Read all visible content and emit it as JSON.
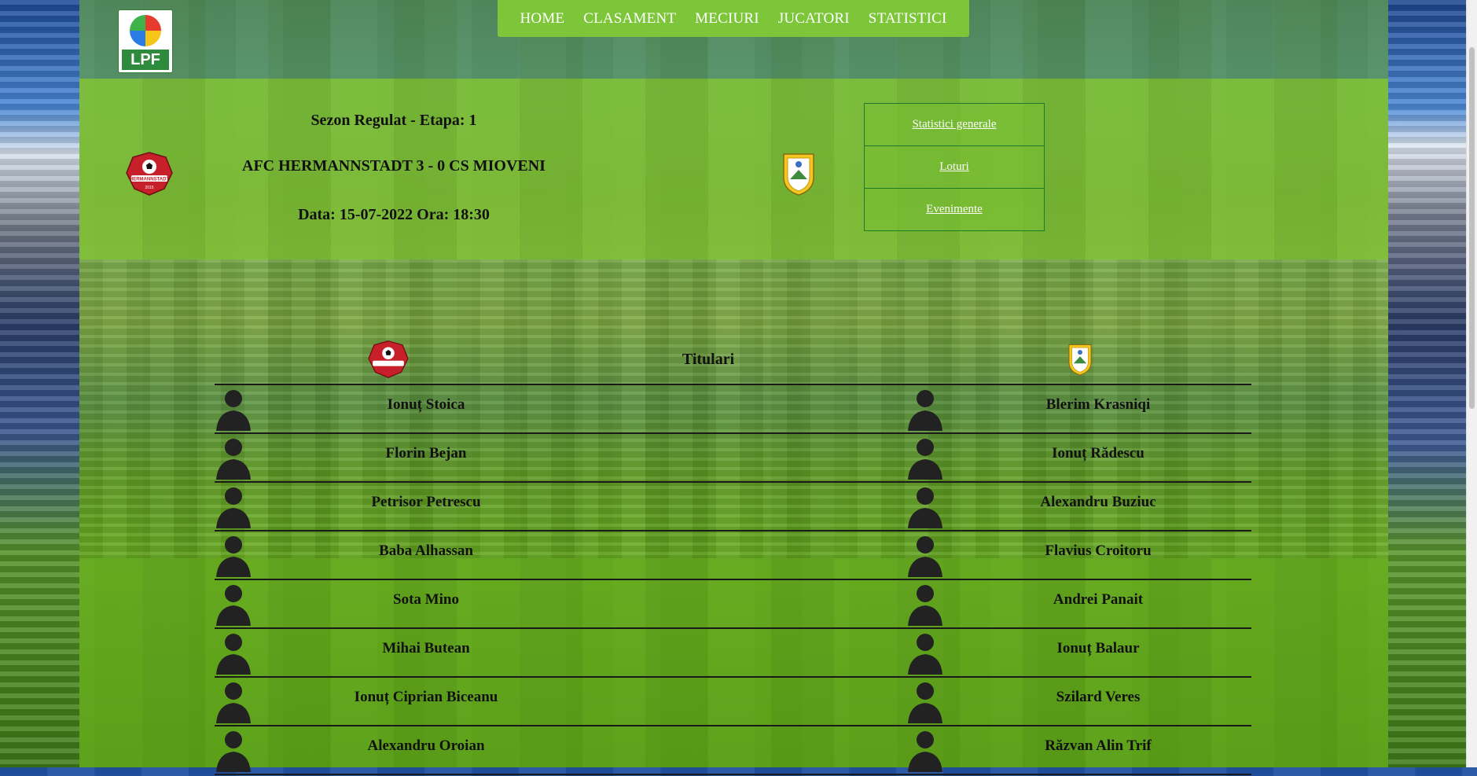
{
  "site": {
    "logo_text": "LPF"
  },
  "nav": {
    "items": [
      "HOME",
      "CLASAMENT",
      "MECIURI",
      "JUCATORI",
      "STATISTICI"
    ]
  },
  "match": {
    "stage": "Sezon Regulat - Etapa: 1",
    "result": "AFC HERMANNSTADT 3 - 0 CS MIOVENI",
    "datetime": "Data: 15-07-2022 Ora: 18:30",
    "home_badge_text": "HERMANNSTADT",
    "home_badge_year": "2015"
  },
  "side_buttons": [
    "Statistici generale",
    "Loturi",
    "Evenimente"
  ],
  "lineups": {
    "title": "Titulari",
    "home": [
      "Ionuț Stoica",
      "Florin Bejan",
      "Petrisor Petrescu",
      "Baba Alhassan",
      "Sota Mino",
      "Mihai Butean",
      "Ionuț Ciprian Biceanu",
      "Alexandru Oroian"
    ],
    "away": [
      "Blerim Krasniqi",
      "Ionuț Rădescu",
      "Alexandru Buziuc",
      "Flavius Croitoru",
      "Andrei Panait",
      "Ionuț Balaur",
      "Szilard Veres",
      "Răzvan Alin Trif"
    ]
  },
  "colors": {
    "nav_bg": "#7dc63a",
    "panel_green": "#82c332",
    "button_border": "#1e7a2c",
    "hermann_red": "#c8202a",
    "mioveni_yellow": "#f3c620"
  },
  "icons": [
    "lpf-logo",
    "hermannstadt-crest",
    "mioveni-crest",
    "player-avatar-icon"
  ]
}
